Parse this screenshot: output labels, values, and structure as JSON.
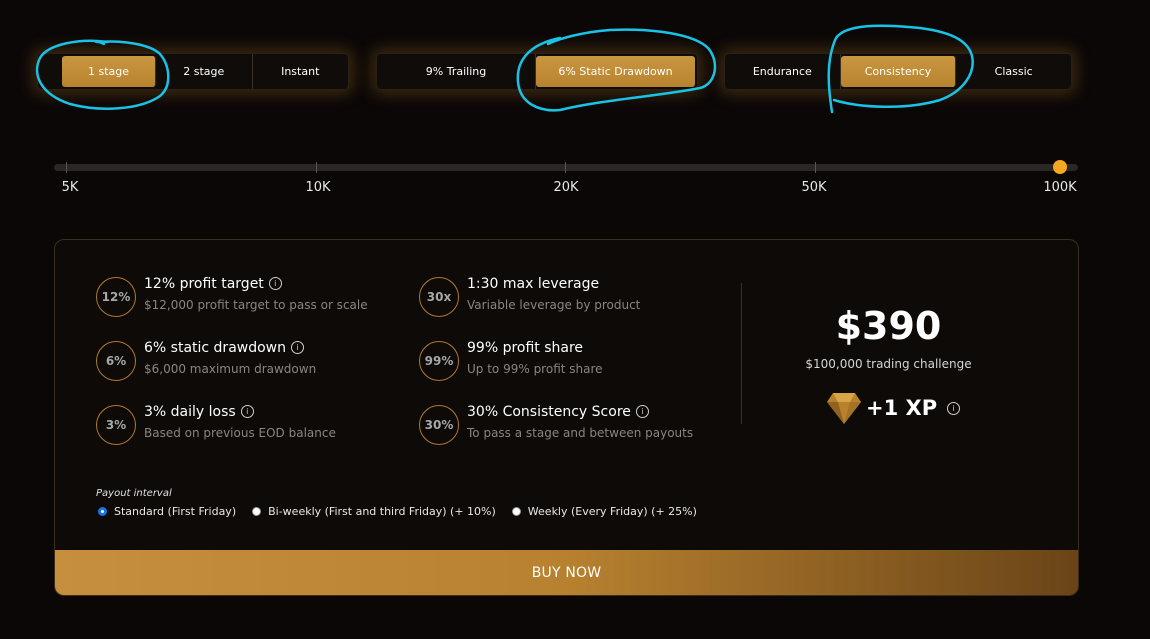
{
  "stage_group": {
    "options": [
      "1 stage",
      "2 stage",
      "Instant"
    ],
    "selected": "1 stage"
  },
  "drawdown_group": {
    "options": [
      "9% Trailing",
      "6% Static Drawdown"
    ],
    "selected": "6% Static Drawdown"
  },
  "style_group": {
    "options": [
      "Endurance",
      "Consistency",
      "Classic"
    ],
    "selected": "Consistency"
  },
  "account_size": {
    "ticks": [
      "5K",
      "10K",
      "20K",
      "50K",
      "100K"
    ],
    "selected": "100K"
  },
  "features": [
    {
      "badge": "12%",
      "title": "12% profit target",
      "subtitle": "$12,000 profit target to pass or scale",
      "info": true
    },
    {
      "badge": "6%",
      "title": "6% static drawdown",
      "subtitle": "$6,000 maximum drawdown",
      "info": true
    },
    {
      "badge": "3%",
      "title": "3% daily loss",
      "subtitle": "Based on previous EOD balance",
      "info": true
    },
    {
      "badge": "30x",
      "title": "1:30 max leverage",
      "subtitle": "Variable leverage by product",
      "info": false
    },
    {
      "badge": "99%",
      "title": "99% profit share",
      "subtitle": "Up to 99% profit share",
      "info": false
    },
    {
      "badge": "30%",
      "title": "30% Consistency Score",
      "subtitle": "To pass a stage and between payouts",
      "info": true
    }
  ],
  "pricing": {
    "price": "$390",
    "subtitle": "$100,000 trading challenge",
    "xp": "+1 XP"
  },
  "payout": {
    "label": "Payout interval",
    "options": [
      "Standard (First Friday)",
      "Bi-weekly (First and third Friday) (+ 10%)",
      "Weekly (Every Friday) (+ 25%)"
    ],
    "selected": "Standard (First Friday)"
  },
  "buy_label": "BUY NOW",
  "info_glyph": "i",
  "colors": {
    "accent": "#c99640",
    "slider_thumb": "#f5a71f",
    "annotation": "#19c3e6",
    "radio_checked": "#1a73e8"
  },
  "icons": {
    "xp": "diamond-icon",
    "info": "info-icon"
  }
}
